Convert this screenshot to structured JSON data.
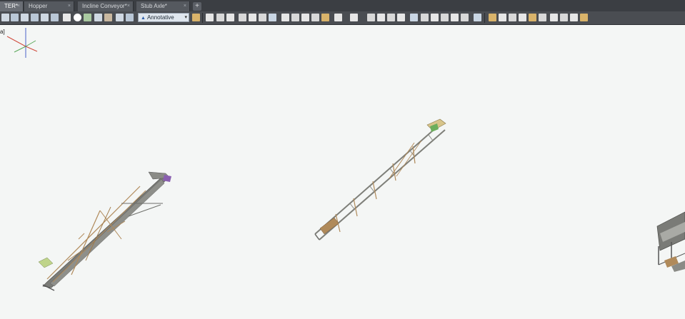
{
  "tabs": [
    {
      "label": "TER*",
      "active": true
    },
    {
      "label": "Hopper",
      "active": false
    },
    {
      "label": "Incline Conveyor*",
      "active": false
    },
    {
      "label": "Stub Axle*",
      "active": false
    }
  ],
  "tab_close_glyph": "×",
  "tab_add_glyph": "+",
  "annotative": {
    "label": "Annotative",
    "arrow": "▾"
  },
  "viewport": {
    "corner_label": "a]"
  },
  "colors": {
    "viewport_bg": "#f4f6f5",
    "tabbar_bg": "#3b3e43",
    "toolbar_bg": "#4a4d52",
    "model_tan": "#b08a5a",
    "model_grey": "#6e6f6b",
    "model_green": "#6cae5c",
    "model_purple": "#8a5fb0"
  }
}
